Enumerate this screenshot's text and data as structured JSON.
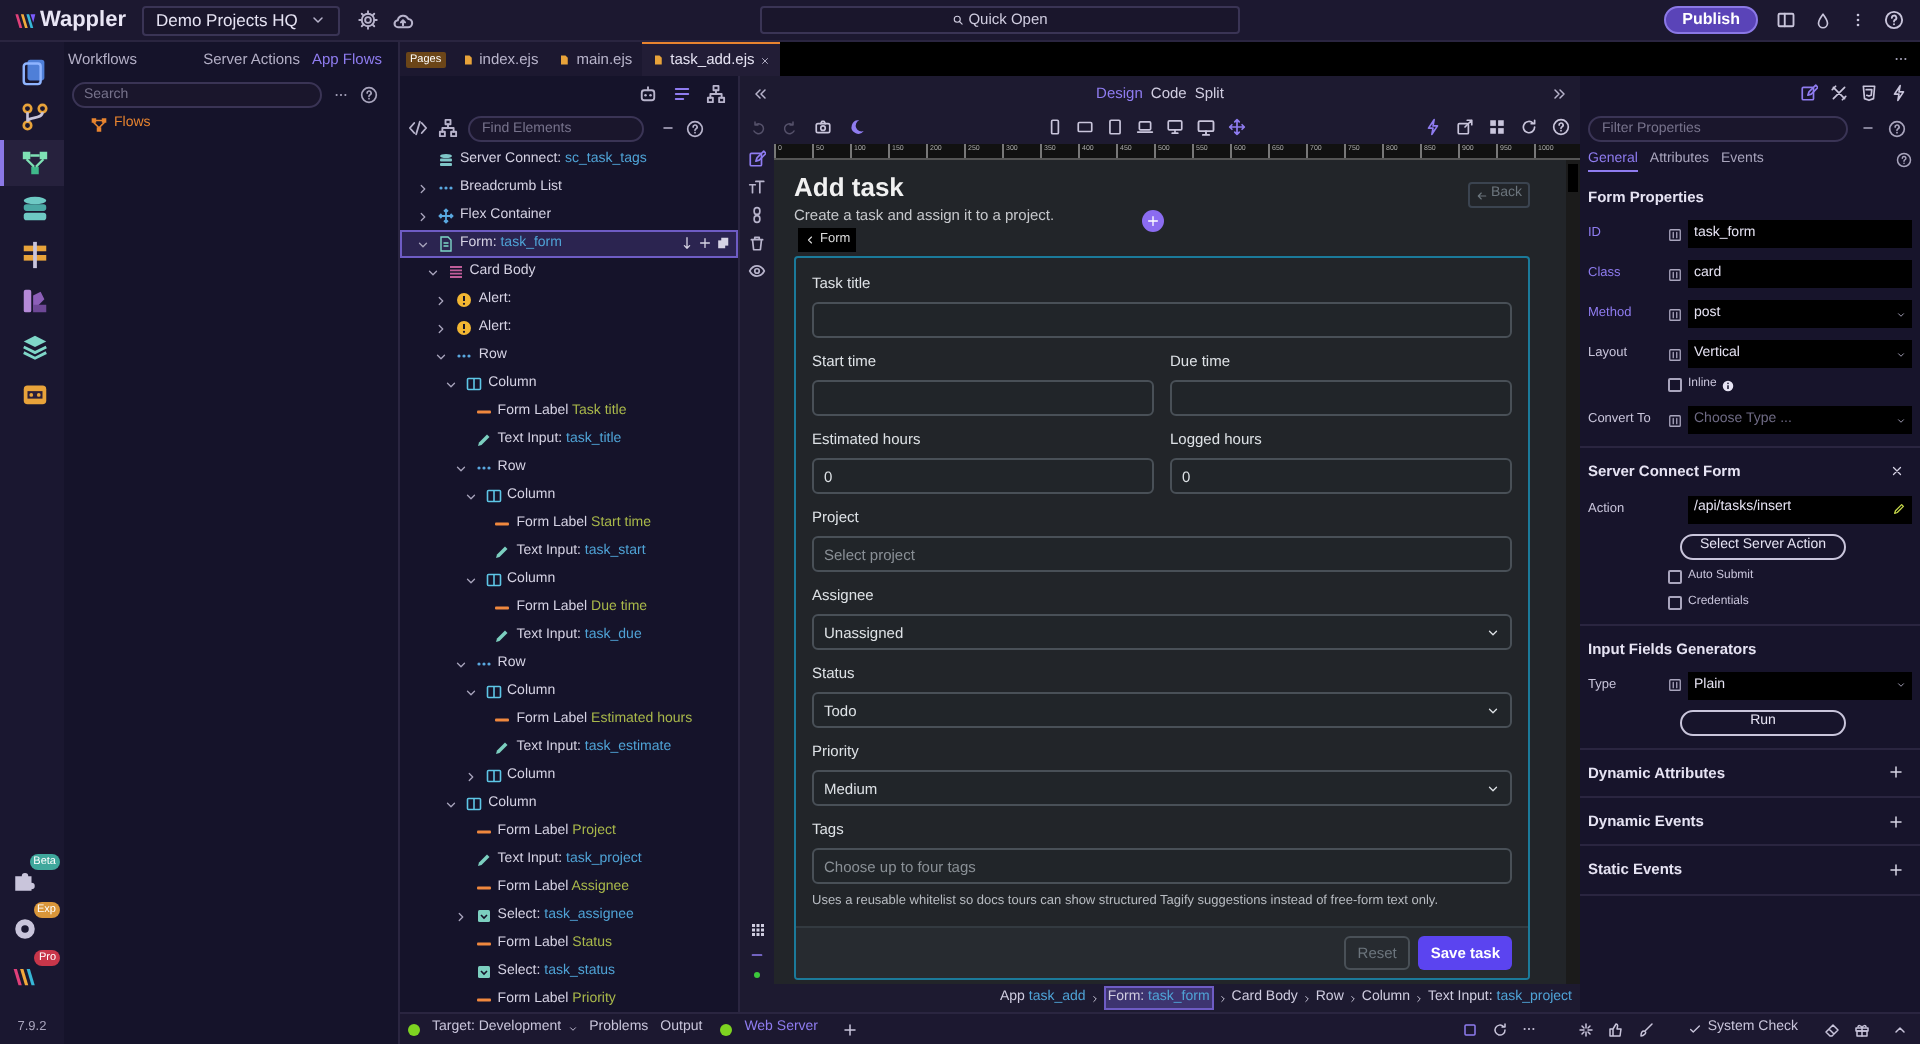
{
  "app": {
    "name": "Wappler",
    "project": "Demo Projects HQ",
    "quick_open": "Quick Open",
    "publish": "Publish",
    "version": "7.9.2"
  },
  "rail": {
    "items": [
      {
        "kind": "pages",
        "selected": false
      },
      {
        "kind": "git",
        "selected": false
      },
      {
        "kind": "flows",
        "selected": true
      },
      {
        "kind": "database",
        "selected": false
      },
      {
        "kind": "routes",
        "selected": false
      },
      {
        "kind": "theme",
        "selected": false
      },
      {
        "kind": "layers",
        "selected": false
      },
      {
        "kind": "robot",
        "selected": false
      }
    ],
    "bottom": [
      {
        "kind": "extensions",
        "badge": "Beta",
        "color": "#3fa79c"
      },
      {
        "kind": "settings",
        "badge": "Exp",
        "color": "#d9963a"
      },
      {
        "kind": "logo",
        "badge": "Pro",
        "color": "#c8364a"
      }
    ]
  },
  "workflows": {
    "title": "Workflows",
    "tabs": [
      {
        "label": "Server Actions",
        "selected": false
      },
      {
        "label": "App Flows",
        "selected": true
      }
    ],
    "search": {
      "placeholder": "Search"
    },
    "items": [
      {
        "label": "Flows"
      }
    ]
  },
  "editor_tabs": {
    "badge": "Pages",
    "tabs": [
      {
        "label": "index.ejs",
        "selected": false
      },
      {
        "label": "main.ejs",
        "selected": false
      },
      {
        "label": "task_add.ejs",
        "selected": true
      }
    ]
  },
  "tree": {
    "search": {
      "placeholder": "Find Elements"
    },
    "nodes": [
      {
        "kind": "server-connect",
        "label": "Server Connect:",
        "value": "sc_task_tags",
        "selected": false
      },
      {
        "kind": "breadcrumb",
        "label": "Breadcrumb List",
        "expanded": false,
        "selected": false
      },
      {
        "kind": "flex",
        "label": "Flex Container",
        "expanded": false,
        "selected": false
      },
      {
        "kind": "form",
        "label": "Form:",
        "value": "task_form",
        "expanded": true,
        "selected": true,
        "children": [
          {
            "kind": "card-body",
            "label": "Card Body",
            "expanded": true,
            "selected": false,
            "children": [
              {
                "kind": "alert",
                "label": "Alert:",
                "expanded": false,
                "selected": false
              },
              {
                "kind": "alert",
                "label": "Alert:",
                "expanded": false,
                "selected": false
              },
              {
                "kind": "row",
                "label": "Row",
                "expanded": true,
                "selected": false,
                "children": [
                  {
                    "kind": "column",
                    "label": "Column",
                    "expanded": true,
                    "selected": false,
                    "children": [
                      {
                        "kind": "label",
                        "label": "Form Label",
                        "value": "Task title",
                        "selected": false
                      },
                      {
                        "kind": "input",
                        "label": "Text Input:",
                        "value": "task_title",
                        "selected": false
                      },
                      {
                        "kind": "row",
                        "label": "Row",
                        "expanded": true,
                        "selected": false,
                        "children": [
                          {
                            "kind": "column",
                            "label": "Column",
                            "expanded": true,
                            "selected": false,
                            "children": [
                              {
                                "kind": "label",
                                "label": "Form Label",
                                "value": "Start time",
                                "selected": false
                              },
                              {
                                "kind": "input",
                                "label": "Text Input:",
                                "value": "task_start",
                                "selected": false
                              }
                            ]
                          },
                          {
                            "kind": "column",
                            "label": "Column",
                            "expanded": true,
                            "selected": false,
                            "children": [
                              {
                                "kind": "label",
                                "label": "Form Label",
                                "value": "Due time",
                                "selected": false
                              },
                              {
                                "kind": "input",
                                "label": "Text Input:",
                                "value": "task_due",
                                "selected": false
                              }
                            ]
                          }
                        ]
                      },
                      {
                        "kind": "row",
                        "label": "Row",
                        "expanded": true,
                        "selected": false,
                        "children": [
                          {
                            "kind": "column",
                            "label": "Column",
                            "expanded": true,
                            "selected": false,
                            "children": [
                              {
                                "kind": "label",
                                "label": "Form Label",
                                "value": "Estimated hours",
                                "selected": false
                              },
                              {
                                "kind": "input",
                                "label": "Text Input:",
                                "value": "task_estimate",
                                "selected": false
                              }
                            ]
                          },
                          {
                            "kind": "column",
                            "label": "Column",
                            "expanded": false,
                            "selected": false
                          }
                        ]
                      }
                    ]
                  },
                  {
                    "kind": "column",
                    "label": "Column",
                    "expanded": true,
                    "selected": false,
                    "children": [
                      {
                        "kind": "label",
                        "label": "Form Label",
                        "value": "Project",
                        "selected": false
                      },
                      {
                        "kind": "input",
                        "label": "Text Input:",
                        "value": "task_project",
                        "selected": false
                      },
                      {
                        "kind": "label",
                        "label": "Form Label",
                        "value": "Assignee",
                        "selected": false
                      },
                      {
                        "kind": "select",
                        "label": "Select:",
                        "value": "task_assignee",
                        "expanded": false,
                        "selected": false
                      },
                      {
                        "kind": "label",
                        "label": "Form Label",
                        "value": "Status",
                        "selected": false
                      },
                      {
                        "kind": "select",
                        "label": "Select:",
                        "value": "task_status",
                        "selected": false
                      },
                      {
                        "kind": "label",
                        "label": "Form Label",
                        "value": "Priority",
                        "selected": false
                      }
                    ]
                  }
                ]
              }
            ]
          }
        ]
      }
    ]
  },
  "design": {
    "modes": [
      {
        "label": "Design",
        "selected": true
      },
      {
        "label": "Code",
        "selected": false
      },
      {
        "label": "Split",
        "selected": false
      }
    ],
    "ruler": [
      "0",
      "50",
      "100",
      "150",
      "200",
      "250",
      "300",
      "350",
      "400",
      "450",
      "500",
      "550",
      "600",
      "650",
      "700",
      "750",
      "800",
      "850",
      "900",
      "950",
      "1000"
    ],
    "page": {
      "title": "Add task",
      "subtitle": "Create a task and assign it to a project.",
      "back": "Back",
      "selection_tag": "Form",
      "rows": [
        {
          "fields": [
            {
              "kind": "text",
              "label": "Task title"
            }
          ]
        },
        {
          "fields": [
            {
              "kind": "text",
              "label": "Start time"
            },
            {
              "kind": "text",
              "label": "Due time"
            }
          ]
        },
        {
          "fields": [
            {
              "kind": "text",
              "label": "Estimated hours",
              "value": "0"
            },
            {
              "kind": "text",
              "label": "Logged hours",
              "value": "0"
            }
          ]
        },
        {
          "fields": [
            {
              "kind": "text",
              "label": "Project",
              "placeholder": "Select project"
            }
          ]
        },
        {
          "fields": [
            {
              "kind": "select",
              "label": "Assignee",
              "value": "Unassigned"
            }
          ]
        },
        {
          "fields": [
            {
              "kind": "select",
              "label": "Status",
              "value": "Todo"
            }
          ]
        },
        {
          "fields": [
            {
              "kind": "select",
              "label": "Priority",
              "value": "Medium"
            }
          ]
        },
        {
          "fields": [
            {
              "kind": "text",
              "label": "Tags",
              "placeholder": "Choose up to four tags"
            }
          ]
        }
      ],
      "help": "Uses a reusable whitelist so docs tours can show structured Tagify suggestions instead of free-form text only.",
      "buttons": [
        {
          "label": "Reset",
          "kind": "secondary"
        },
        {
          "label": "Save task",
          "kind": "primary"
        }
      ]
    },
    "breadcrumb": [
      {
        "label": "App",
        "value": "task_add",
        "selected": false
      },
      {
        "label": "Form:",
        "value": "task_form",
        "selected": true
      },
      {
        "label": "Card Body",
        "selected": false
      },
      {
        "label": "Row",
        "selected": false
      },
      {
        "label": "Column",
        "selected": false
      },
      {
        "label": "Text Input:",
        "value": "task_project",
        "selected": false
      }
    ]
  },
  "properties": {
    "filter": {
      "placeholder": "Filter Properties"
    },
    "tabs": [
      {
        "label": "General",
        "selected": true
      },
      {
        "label": "Attributes",
        "selected": false
      },
      {
        "label": "Events",
        "selected": false
      }
    ],
    "sections": [
      {
        "kind": "panel",
        "title": "Form Properties",
        "rows": [
          {
            "kind": "input",
            "label": "ID",
            "value": "task_form",
            "set": true
          },
          {
            "kind": "input",
            "label": "Class",
            "value": "card",
            "set": true
          },
          {
            "kind": "select",
            "label": "Method",
            "value": "post",
            "set": true
          },
          {
            "kind": "select",
            "label": "Layout",
            "value": "Vertical",
            "set": false
          },
          {
            "kind": "checkbox",
            "label": "Inline",
            "checked": false,
            "info": true
          },
          {
            "kind": "select",
            "label": "Convert To",
            "placeholder": "Choose Type ...",
            "set": false
          }
        ]
      },
      {
        "kind": "panel",
        "title": "Server Connect Form",
        "closable": true,
        "rows": [
          {
            "kind": "action",
            "label": "Action",
            "value": "/api/tasks/insert"
          },
          {
            "kind": "button",
            "label": "Select Server Action"
          },
          {
            "kind": "checkbox",
            "label": "Auto Submit",
            "checked": false
          },
          {
            "kind": "checkbox",
            "label": "Credentials",
            "checked": false
          }
        ]
      },
      {
        "kind": "panel",
        "title": "Input Fields Generators",
        "rows": [
          {
            "kind": "select",
            "label": "Type",
            "value": "Plain",
            "set": false
          },
          {
            "kind": "button",
            "label": "Run"
          }
        ]
      },
      {
        "kind": "collapsed",
        "title": "Dynamic Attributes"
      },
      {
        "kind": "collapsed",
        "title": "Dynamic Events"
      },
      {
        "kind": "collapsed",
        "title": "Static Events"
      }
    ]
  },
  "status_bar": {
    "target": "Target: Development",
    "items": [
      "Problems",
      "Output"
    ],
    "server": {
      "label": "Web Server",
      "running": true
    },
    "system_check": "System Check"
  }
}
